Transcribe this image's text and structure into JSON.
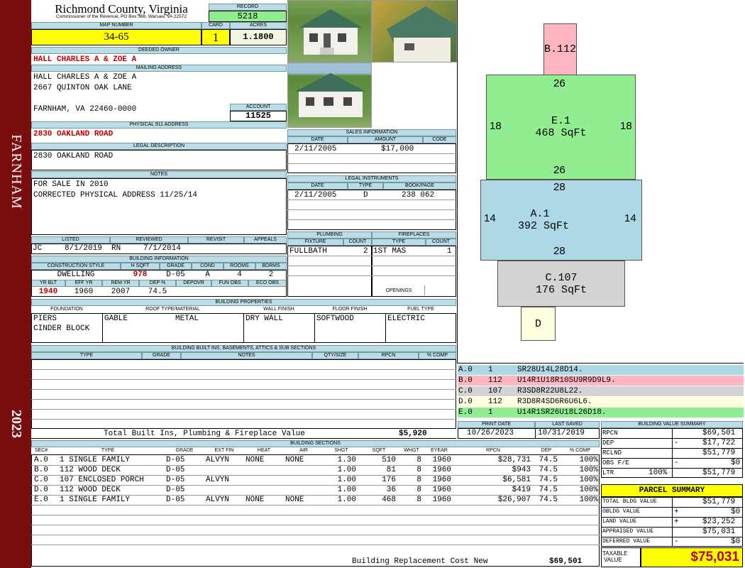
{
  "sidebar": {
    "town": "FARNHAM",
    "year": "2023"
  },
  "header": {
    "title": "Richmond County, Virginia",
    "subtitle": "Commissioner of the Revenue, PO Box 366, Warsaw, VA 22572",
    "record_label": "RECORD",
    "record": "5218",
    "map_number_label": "MAP NUMBER",
    "map_number": "34-65",
    "card_label": "CARD",
    "card": "1",
    "acres_label": "ACRES",
    "acres": "1.1800"
  },
  "owner": {
    "deeded_owner_label": "DEEDED OWNER",
    "deeded_owner": "HALL CHARLES A & ZOE A",
    "mailing_address_label": "MAILING ADDRESS",
    "mail_line1": "HALL CHARLES A & ZOE A",
    "mail_line2": "2667 QUINTON OAK LANE",
    "mail_line3": "FARNHAM, VA 22460-0000",
    "account_label": "ACCOUNT",
    "account": "11525",
    "physical_label": "PHYSICAL 911 ADDRESS",
    "physical": "2830 OAKLAND ROAD",
    "legal_label": "LEGAL DESCRIPTION",
    "legal": "2830 OAKLAND ROAD",
    "notes_label": "NOTES",
    "notes1": "FOR SALE IN 2010",
    "notes2": "CORRECTED PHYSICAL ADDRESS 11/25/14"
  },
  "review": {
    "listed_label": "LISTED",
    "reviewed_label": "REVIEWED",
    "revisit_label": "REVISIT",
    "appeals_label": "APPEALS",
    "listed_by": "JC",
    "listed_date": "8/1/2019",
    "reviewed_by": "RN",
    "reviewed_date": "7/1/2014"
  },
  "building_info": {
    "label": "BUILDING INFORMATION",
    "cols": [
      "CONSTRUCTION STYLE",
      "H SQFT",
      "GRADE",
      "COND",
      "ROOMS",
      "BDRMS"
    ],
    "vals": [
      "DWELLING",
      "978",
      "D-05",
      "A",
      "4",
      "2"
    ],
    "cols2": [
      "YR BLT",
      "EFF YR",
      "REM YR",
      "DEP %",
      "DEPOVR",
      "FUN OBS",
      "ECO OBS"
    ],
    "vals2": [
      "1940",
      "1960",
      "2007",
      "74.5",
      "",
      "",
      ""
    ]
  },
  "sales": {
    "label": "SALES INFORMATION",
    "cols": [
      "DATE",
      "AMOUNT",
      "CODE"
    ],
    "date": "2/11/2005",
    "amount": "$17,000"
  },
  "legal_instruments": {
    "label": "LEGAL INSTRUMENTS",
    "cols": [
      "DATE",
      "TYPE",
      "BOOK/PAGE"
    ],
    "date": "2/11/2005",
    "type": "D",
    "bookpage": "238 062"
  },
  "plumbing": {
    "label": "PLUMBING",
    "fixture_label": "FIXTURE",
    "count_label": "COUNT",
    "fixture": "FULLBATH",
    "count": "2"
  },
  "fireplaces": {
    "label": "FIREPLACES",
    "type_label": "TYPE",
    "count_label": "COUNT",
    "type": "1ST MAS",
    "count": "1",
    "openings_label": "OPENINGS"
  },
  "properties": {
    "label": "BUILDING PROPERTIES",
    "cols": [
      "FOUNDATION",
      "ROOF TYPE/MATERIAL",
      "WALL FINISH",
      "FLOOR FINISH",
      "FUEL TYPE"
    ],
    "foundation1": "PIERS",
    "foundation2": "CINDER BLOCK",
    "roof_type": "GABLE",
    "roof_material": "METAL",
    "wall": "DRY WALL",
    "floor": "SOFTWOOD",
    "fuel": "ELECTRIC"
  },
  "builtins": {
    "label": "BUILDING BUILT INS, BASEMENTS, ATTICS & SUB SECTIONS",
    "cols": [
      "TYPE",
      "GRADE",
      "NOTES",
      "QTY/SIZE",
      "RPCN",
      "% COMP"
    ],
    "total_label": "Total Built Ins, Plumbing & Fireplace Value",
    "total": "$5,920"
  },
  "print": {
    "print_label": "PRINT DATE",
    "saved_label": "LAST SAVED",
    "print_date": "10/26/2023",
    "last_saved": "10/31/2019"
  },
  "sections": {
    "label": "BUILDING SECTIONS",
    "cols": [
      "SEC#",
      "TYPE",
      "GRADE",
      "EXT FIN",
      "HEAT",
      "AIR",
      "SHGT",
      "SQFT",
      "WHGT",
      "EYEAR",
      "RPCN",
      "DEP",
      "% COMP"
    ],
    "rows": [
      [
        "A.0",
        "1 SINGLE FAMILY",
        "D-05",
        "ALVYN",
        "NONE",
        "NONE",
        "1.30",
        "510",
        "8",
        "1960",
        "$28,731",
        "74.5",
        "100%"
      ],
      [
        "B.0",
        "112 WOOD DECK",
        "D-05",
        "",
        "",
        "",
        "1.00",
        "81",
        "8",
        "1960",
        "$943",
        "74.5",
        "100%"
      ],
      [
        "C.0",
        "107 ENCLOSED PORCH",
        "D-05",
        "ALVYN",
        "",
        "",
        "1.00",
        "176",
        "8",
        "1960",
        "$6,581",
        "74.5",
        "100%"
      ],
      [
        "D.0",
        "112 WOOD DECK",
        "D-05",
        "",
        "",
        "",
        "1.00",
        "36",
        "8",
        "1960",
        "$419",
        "74.5",
        "100%"
      ],
      [
        "E.0",
        "1 SINGLE FAMILY",
        "D-05",
        "ALVYN",
        "NONE",
        "NONE",
        "1.00",
        "468",
        "8",
        "1960",
        "$26,907",
        "74.5",
        "100%"
      ]
    ],
    "replacement_label": "Building Replacement Cost New",
    "replacement": "$69,501"
  },
  "sketch": {
    "b_label": "B.112",
    "e_label": "E.1",
    "e_area": "468 SqFt",
    "e_top": "26",
    "e_bottom": "26",
    "e_left": "18",
    "e_right": "18",
    "a_label": "A.1",
    "a_area": "392 SqFt",
    "a_top": "28",
    "a_bottom": "28",
    "a_left": "14",
    "a_right": "14",
    "c_label": "C.107",
    "c_area": "176 SqFt",
    "d_label": "D",
    "codes": [
      {
        "sec": "A.0",
        "num": "1",
        "code": "SR28U14L28D14."
      },
      {
        "sec": "B.0",
        "num": "112",
        "code": "U14R1U18R10SU9R9D9L9."
      },
      {
        "sec": "C.0",
        "num": "107",
        "code": "R3SD8R22U8L22."
      },
      {
        "sec": "D.0",
        "num": "112",
        "code": "R3D8R4SD6R6U6L6."
      },
      {
        "sec": "E.0",
        "num": "1",
        "code": "U14R1SR26U18L26D18."
      }
    ],
    "colors": {
      "a": "#add8e6",
      "b": "#ffb6c1",
      "c": "#d3d3d3",
      "d": "#ffffe0",
      "e": "#90ee90"
    }
  },
  "bldg_value": {
    "label": "BUILDING VALUE SUMMARY",
    "rpcn_label": "RPCN",
    "rpcn": "$69,501",
    "dep_label": "DEP",
    "dep_sign": "-",
    "dep": "$17,722",
    "rclnd_label": "RCLND",
    "rclnd": "$51,779",
    "obs_label": "OBS F/E",
    "obs_sign": "-",
    "obs": "$0",
    "ltr_label": "LTR",
    "ltr_pct": "100%",
    "ltr": "$51,779"
  },
  "parcel": {
    "label": "PARCEL SUMMARY",
    "total_bldg_label": "TOTAL BLDG VALUE",
    "total_bldg": "$51,779",
    "obldg_label": "OBLDG VALUE",
    "obldg_sign": "+",
    "obldg": "$0",
    "land_label": "LAND VALUE",
    "land_sign": "+",
    "land": "$23,252",
    "appraised_label": "APPRAISED VALUE",
    "appraised": "$75,031",
    "deferred_label": "DEFERRED VALUE",
    "deferred_sign": "-",
    "deferred": "$0",
    "taxable_label1": "TAXABLE",
    "taxable_label2": "VALUE",
    "taxable": "$75,031"
  }
}
